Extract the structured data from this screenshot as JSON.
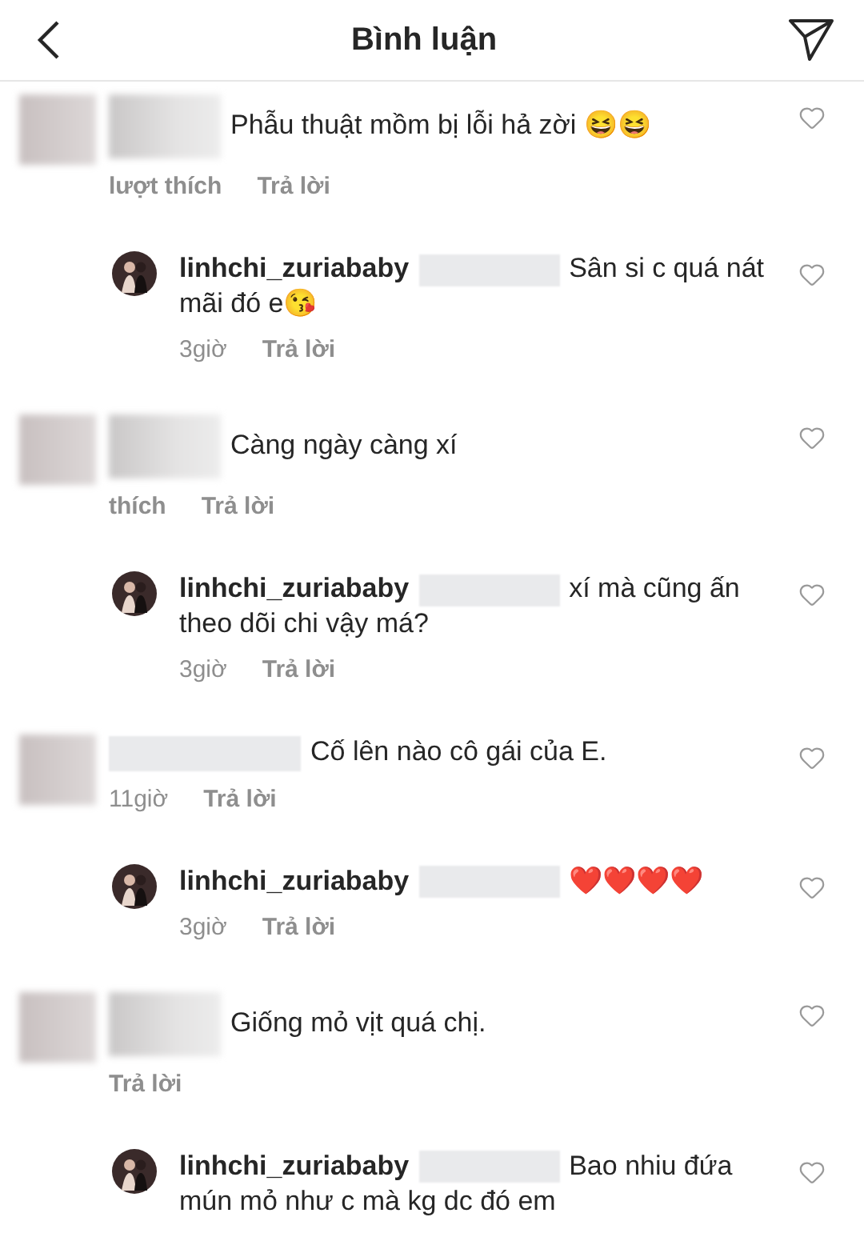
{
  "header": {
    "title": "Bình luận"
  },
  "comments": [
    {
      "kind": "comment",
      "text": "Phẫu thuật mồm bị lỗi hả zời 😆😆",
      "likes": "lượt thích",
      "reply_label": "Trả lời"
    },
    {
      "kind": "reply",
      "username": "linhchi_zuriababy",
      "text": "Sân si c quá nát mãi đó e😘",
      "time": "3giờ",
      "reply_label": "Trả lời"
    },
    {
      "kind": "comment",
      "text": "Càng ngày càng xí",
      "likes": "thích",
      "reply_label": "Trả lời"
    },
    {
      "kind": "reply",
      "username": "linhchi_zuriababy",
      "text": "xí mà cũng ấn theo dõi chi vậy má?",
      "time": "3giờ",
      "reply_label": "Trả lời"
    },
    {
      "kind": "comment",
      "text": "Cố lên nào cô gái của E.",
      "time": "11giờ",
      "reply_label": "Trả lời"
    },
    {
      "kind": "reply",
      "username": "linhchi_zuriababy",
      "text": "❤️❤️❤️❤️",
      "time": "3giờ",
      "reply_label": "Trả lời"
    },
    {
      "kind": "comment",
      "text": "Giống mỏ vịt quá chị.",
      "reply_label": "Trả lời"
    },
    {
      "kind": "reply",
      "username": "linhchi_zuriababy",
      "text": "Bao nhiu đứa mún mỏ như c mà kg dc đó em"
    }
  ]
}
